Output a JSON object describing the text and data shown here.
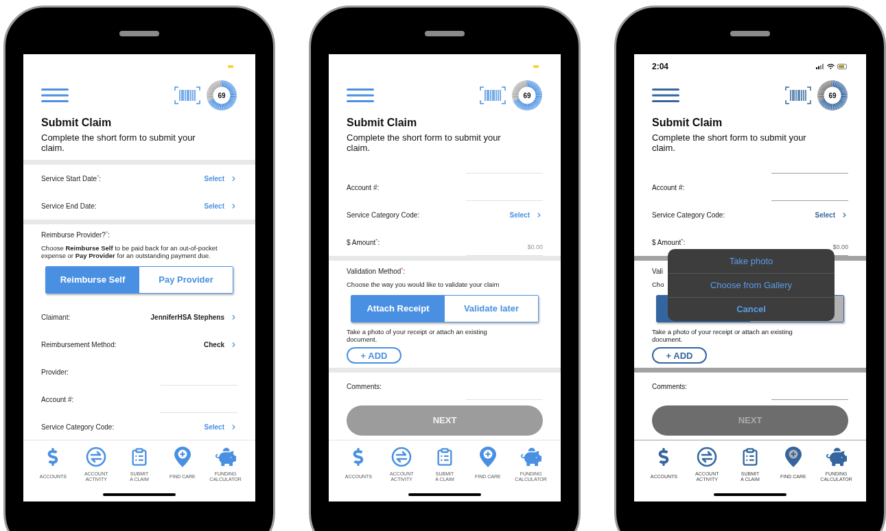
{
  "phones": [
    {
      "dimmed": false,
      "score": {
        "value": "69"
      },
      "title": "Submit Claim",
      "subtitle": "Complete the short form to submit your claim.",
      "rows": [
        {
          "kind": "gap"
        },
        {
          "kind": "select",
          "label": "Service Start Date$^{*}$:",
          "value": "Select",
          "chosen": false
        },
        {
          "kind": "select",
          "label": "Service End Date:",
          "value": "Select",
          "chosen": false
        },
        {
          "kind": "gap"
        },
        {
          "kind": "choice",
          "label": "Reimburse Provider?$^{*}$:",
          "description": "Choose **Reimburse Self** to be paid back for an out-of-pocket expense or **Pay Provider** for an outstanding payment due.",
          "options": [
            {
              "label": "Reimburse Self",
              "selected": true
            },
            {
              "label": "Pay Provider",
              "selected": false
            }
          ]
        },
        {
          "kind": "select",
          "label": "Claimant:",
          "value": "JenniferHSA Stephens",
          "chosen": true
        },
        {
          "kind": "select",
          "label": "Reimbursement Method:",
          "value": "Check",
          "chosen": true
        },
        {
          "kind": "input",
          "label": "Provider:"
        },
        {
          "kind": "input",
          "label": "Account #:"
        },
        {
          "kind": "select",
          "label": "Service Category Code:",
          "value": "Select",
          "chosen": false
        }
      ],
      "nav": [
        {
          "kind": "dollar",
          "label": "ACCOUNTS"
        },
        {
          "kind": "exchange",
          "label": "ACCOUNT\nACTIVITY"
        },
        {
          "kind": "clipboard",
          "label": "SUBMIT\nA CLAIM"
        },
        {
          "kind": "pin",
          "label": "FIND CARE"
        },
        {
          "kind": "piggy",
          "label": "FUNDING\nCALCULATOR"
        }
      ]
    },
    {
      "dimmed": false,
      "score": {
        "value": "69"
      },
      "title": "Submit Claim",
      "subtitle": "Complete the short form to submit your claim.",
      "rows": [
        {
          "kind": "cut"
        },
        {
          "kind": "input",
          "label": "Account #:"
        },
        {
          "kind": "select",
          "label": "Service Category Code:",
          "value": "Select",
          "chosen": false
        },
        {
          "kind": "input",
          "label": "$ Amount$^{*}$:",
          "placeholder": "$0.00"
        },
        {
          "kind": "gap"
        },
        {
          "kind": "choice",
          "label": "Validation Method$^{*}$:",
          "description": "Choose the way you would like to validate your claim",
          "options": [
            {
              "label": "Attach Receipt",
              "selected": true
            },
            {
              "label": "Validate later",
              "selected": false
            }
          ],
          "note": "Take a photo of your receipt or attach an existing document.",
          "button": "+ ADD"
        },
        {
          "kind": "gap"
        },
        {
          "kind": "input",
          "label": "Comments:"
        },
        {
          "kind": "next",
          "label": "NEXT",
          "disabled": true
        },
        {
          "kind": "gap"
        }
      ],
      "nav": [
        {
          "kind": "dollar",
          "label": "ACCOUNTS"
        },
        {
          "kind": "exchange",
          "label": "ACCOUNT\nACTIVITY"
        },
        {
          "kind": "clipboard",
          "label": "SUBMIT\nA CLAIM"
        },
        {
          "kind": "pin",
          "label": "FIND CARE"
        },
        {
          "kind": "piggy",
          "label": "FUNDING\nCALCULATOR"
        }
      ]
    },
    {
      "time": "2:04",
      "dimmed": true,
      "score": {
        "value": "69"
      },
      "title": "Submit Claim",
      "subtitle": "Complete the short form to submit your claim.",
      "rows": [
        {
          "kind": "cut"
        },
        {
          "kind": "input",
          "label": "Account #:"
        },
        {
          "kind": "select",
          "label": "Service Category Code:",
          "value": "Select",
          "chosen": false
        },
        {
          "kind": "input",
          "label": "$ Amount$^{*}$:",
          "placeholder": "$0.00"
        },
        {
          "kind": "gap"
        },
        {
          "kind": "choice",
          "label": "Vali",
          "description": "Cho",
          "options": [
            {
              "selected": true
            },
            {
              "selected": false
            }
          ],
          "note": "Take a photo of your receipt or attach an existing document.",
          "button": "+ ADD"
        },
        {
          "kind": "gap"
        },
        {
          "kind": "input",
          "label": "Comments:"
        },
        {
          "kind": "next",
          "label": "NEXT",
          "disabled": true
        },
        {
          "kind": "gap"
        }
      ],
      "sheet": [
        {
          "kind": "action",
          "label": "Take photo"
        },
        {
          "kind": "action",
          "label": "Choose from Gallery"
        },
        {
          "kind": "cancel",
          "label": "Cancel"
        }
      ],
      "nav": [
        {
          "kind": "dollar",
          "label": "ACCOUNTS"
        },
        {
          "kind": "exchange",
          "label": "ACCOUNT\nACTIVITY"
        },
        {
          "kind": "clipboard",
          "label": "SUBMIT\nA CLAIM"
        },
        {
          "kind": "pin",
          "label": "FIND CARE"
        },
        {
          "kind": "piggy",
          "label": "FUNDING\nCALCULATOR"
        }
      ]
    }
  ]
}
